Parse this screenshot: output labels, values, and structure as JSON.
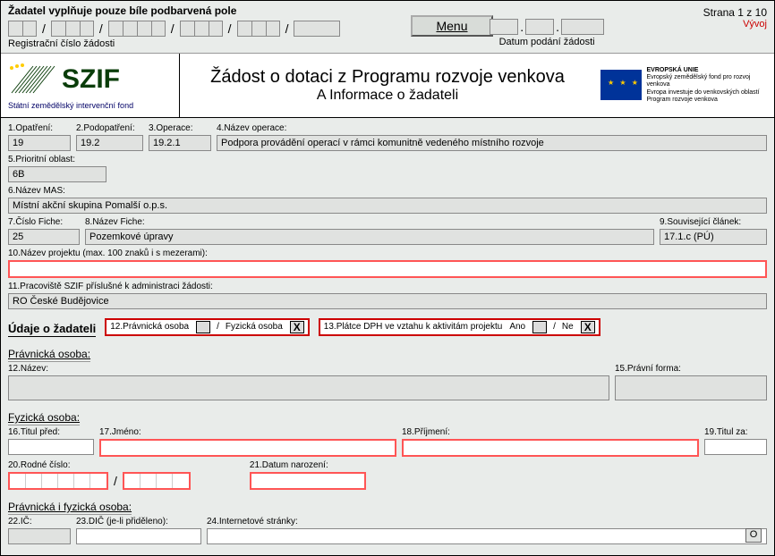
{
  "top": {
    "instruction": "Žadatel vyplňuje pouze bíle podbarvená pole",
    "reg_label": "Registrační číslo žádosti",
    "date_label": "Datum podání žádosti",
    "menu": "Menu",
    "page_meta": "Strana 1 z 10",
    "mode": "Vývoj"
  },
  "header": {
    "logo_text": "SZIF",
    "logo_sub": "Státní zemědělský intervenční fond",
    "title": "Žádost o dotaci z Programu rozvoje venkova",
    "subtitle": "A Informace o žadateli",
    "eu_title": "EVROPSKÁ UNIE",
    "eu_l1": "Evropský zemědělský fond pro rozvoj venkova",
    "eu_l2": "Evropa investuje do venkovských oblastí",
    "eu_l3": "Program rozvoje venkova"
  },
  "f": {
    "l1": "1.Opatření:",
    "v1": "19",
    "l2": "2.Podopatření:",
    "v2": "19.2",
    "l3": "3.Operace:",
    "v3": "19.2.1",
    "l4": "4.Název operace:",
    "v4": "Podpora provádění operací v rámci komunitně vedeného místního rozvoje",
    "l5": "5.Prioritní oblast:",
    "v5": "6B",
    "l6": "6.Název MAS:",
    "v6": "Místní akční skupina Pomalší o.p.s.",
    "l7": "7.Číslo Fiche:",
    "v7": "25",
    "l8": "8.Název Fiche:",
    "v8": "Pozemkové úpravy",
    "l9": "9.Související článek:",
    "v9": "17.1.c (PÚ)",
    "l10": "10.Název projektu (max. 100 znaků i s mezerami):",
    "v10": "",
    "l11": "11.Pracoviště SZIF příslušné k administraci žádosti:",
    "v11": "RO České Budějovice"
  },
  "applicant": {
    "section": "Údaje o žadateli",
    "t12_label": "12.Právnická osoba",
    "t12_altlabel": "Fyzická osoba",
    "t13_label": "13.Plátce DPH ve vztahu k aktivitám projektu",
    "yes": "Ano",
    "no": "Ne",
    "x": "X",
    "po_title": "Právnická osoba:",
    "l12": "12.Název:",
    "l15": "15.Právní forma:",
    "fo_title": "Fyzická osoba:",
    "l16": "16.Titul před:",
    "l17": "17.Jméno:",
    "l18": "18.Příjmení:",
    "l19": "19.Titul za:",
    "l20": "20.Rodné číslo:",
    "l21": "21.Datum narození:",
    "both_title": "Právnická i fyzická osoba:",
    "l22": "22.IČ:",
    "l23": "23.DIČ (je-li přiděleno):",
    "l24": "24.Internetové stránky:",
    "o_btn": "O"
  }
}
